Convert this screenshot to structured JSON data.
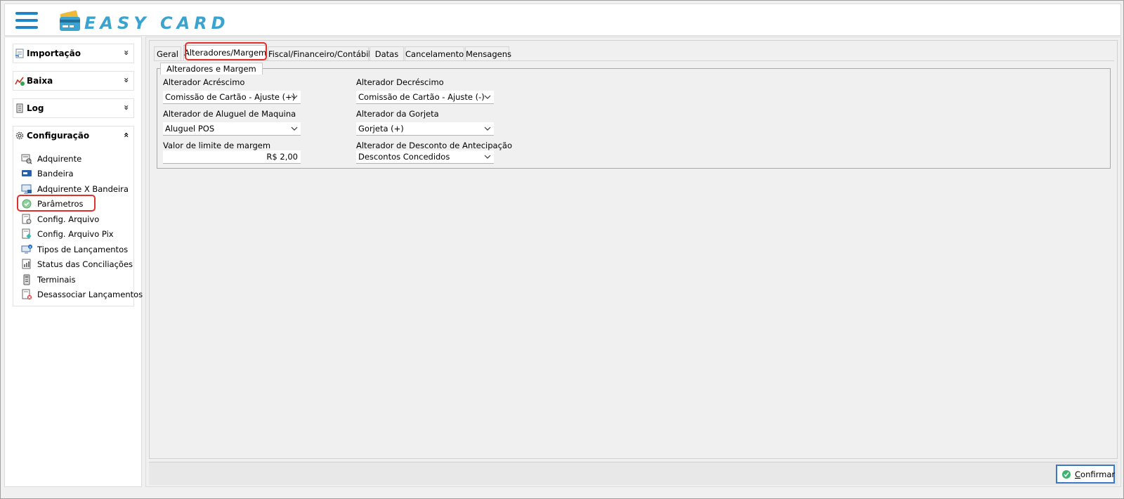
{
  "header": {
    "menu_icon": "hamburger-menu-icon",
    "logo_icon": "credit-card-wallet-icon",
    "logo_text": "EASY CARD"
  },
  "sidebar": {
    "groups": [
      {
        "label": "Importação",
        "icon": "import-document-icon",
        "chevron": "»"
      },
      {
        "label": "Baixa",
        "icon": "chart-check-icon",
        "chevron": "»"
      },
      {
        "label": "Log",
        "icon": "log-file-icon",
        "chevron": "»"
      }
    ],
    "config": {
      "label": "Configuração",
      "icon": "gear-icon",
      "chevron": "«",
      "items": [
        {
          "label": "Adquirente",
          "icon": "acquirer-icon"
        },
        {
          "label": "Bandeira",
          "icon": "card-brand-icon"
        },
        {
          "label": "Adquirente X Bandeira",
          "icon": "monitor-card-icon"
        },
        {
          "label": "Parâmetros",
          "icon": "green-check-icon"
        },
        {
          "label": "Config. Arquivo",
          "icon": "file-gear-icon"
        },
        {
          "label": "Config. Arquivo Pix",
          "icon": "file-pix-icon"
        },
        {
          "label": "Tipos de Lançamentos",
          "icon": "monitor-info-icon"
        },
        {
          "label": "Status das Conciliações",
          "icon": "status-doc-icon"
        },
        {
          "label": "Terminais",
          "icon": "pos-terminal-icon"
        },
        {
          "label": "Desassociar Lançamentos",
          "icon": "unlink-doc-icon"
        }
      ],
      "selected": "Parâmetros"
    }
  },
  "tabs": [
    {
      "label": "Geral"
    },
    {
      "label": "Alteradores/Margem"
    },
    {
      "label": "Fiscal/Financeiro/Contábil"
    },
    {
      "label": "Datas"
    },
    {
      "label": "Cancelamento"
    },
    {
      "label": "Mensagens"
    }
  ],
  "active_tab": "Alteradores/Margem",
  "group": {
    "title": "Alteradores e Margem",
    "fields": {
      "acrescimo": {
        "label": "Alterador Acréscimo",
        "value": "Comissão de Cartão - Ajuste (+)"
      },
      "decrescimo": {
        "label": "Alterador Decréscimo",
        "value": "Comissão de Cartão - Ajuste (-)"
      },
      "aluguel": {
        "label": "Alterador de Aluguel de Maquina",
        "value": "Aluguel POS"
      },
      "gorjeta": {
        "label": "Alterador da Gorjeta",
        "value": "Gorjeta (+)"
      },
      "limite": {
        "label": "Valor de limite de margem",
        "value": "R$ 2,00"
      },
      "antecipacao": {
        "label": "Alterador de Desconto de Antecipação",
        "value": "Descontos Concedidos"
      }
    }
  },
  "footer": {
    "confirm_label": "Confirmar",
    "confirm_icon": "green-check-icon"
  },
  "colors": {
    "accent": "#1d86c8",
    "logo": "#3aa3cf",
    "highlight": "#e0302a",
    "button_border": "#3c78c8"
  }
}
